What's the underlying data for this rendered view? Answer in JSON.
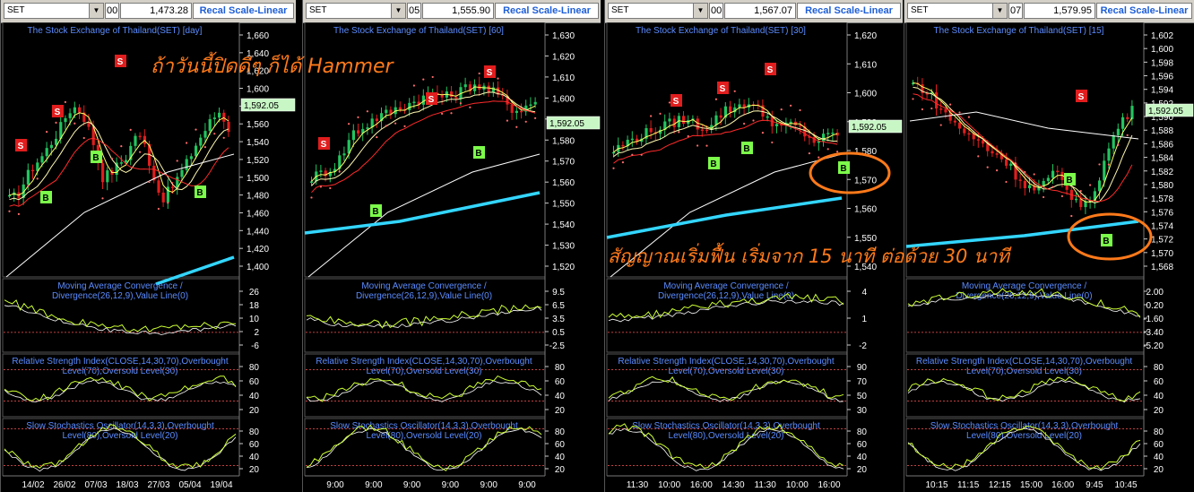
{
  "panels": [
    {
      "symbol": "SET",
      "period_box": "00",
      "price_box": "1,473.28",
      "recal_label": "Recal Scale-Linear",
      "title": "The Stock Exchange of Thailand(SET) [day]",
      "last_price": "1,592.05",
      "price_ticks": [
        "1,660",
        "1,640",
        "1,620",
        "1,600",
        "1,580",
        "1,560",
        "1,540",
        "1,520",
        "1,500",
        "1,480",
        "1,460",
        "1,440",
        "1,420",
        "1,400"
      ],
      "macd_title_1": "Moving Average Convergence /",
      "macd_title_2": "Divergence(26,12,9),Value Line(0)",
      "macd_ticks": [
        "26",
        "18",
        "10",
        "2",
        "-6"
      ],
      "rsi_title_1": "Relative Strength Index(CLOSE,14,30,70),Overbought",
      "rsi_title_2": "Level(70),Oversold Level(30)",
      "rsi_ticks": [
        "80",
        "60",
        "40",
        "20"
      ],
      "sto_title_1": "Slow Stochastics Oscillator(14,3,3),Overbought",
      "sto_title_2": "Level(80),Oversold Level(20)",
      "sto_ticks": [
        "80",
        "60",
        "40",
        "20"
      ],
      "date_ticks": [
        "14/02",
        "26/02",
        "07/03",
        "18/03",
        "27/03",
        "05/04",
        "19/04"
      ]
    },
    {
      "symbol": "SET",
      "period_box": "05",
      "price_box": "1,555.90",
      "recal_label": "Recal Scale-Linear",
      "title": "The Stock Exchange of Thailand(SET) [60]",
      "last_price": "1,592.05",
      "price_ticks": [
        "1,630",
        "1,620",
        "1,610",
        "1,600",
        "1,590",
        "1,580",
        "1,570",
        "1,560",
        "1,550",
        "1,540",
        "1,530",
        "1,520"
      ],
      "macd_title_1": "Moving Average Convergence /",
      "macd_title_2": "Divergence(26,12,9),Value Line(0)",
      "macd_ticks": [
        "9.5",
        "6.5",
        "3.5",
        "0.5",
        "-2.5"
      ],
      "rsi_title_1": "Relative Strength Index(CLOSE,14,30,70),Overbought",
      "rsi_title_2": "Level(70),Oversold Level(30)",
      "rsi_ticks": [
        "80",
        "60",
        "40",
        "20"
      ],
      "sto_title_1": "Slow Stochastics Oscillator(14,3,3),Overbought",
      "sto_title_2": "Level(80),Oversold Level(20)",
      "sto_ticks": [
        "80",
        "60",
        "40",
        "20"
      ],
      "date_ticks": [
        "9:00",
        "9:00",
        "9:00",
        "9:00",
        "9:00",
        "9:00"
      ]
    },
    {
      "symbol": "SET",
      "period_box": "00",
      "price_box": "1,567.07",
      "recal_label": "Recal Scale-Linear",
      "title": "The Stock Exchange of Thailand(SET) [30]",
      "last_price": "1,592.05",
      "price_ticks": [
        "1,620",
        "1,610",
        "1,600",
        "1,590",
        "1,580",
        "1,570",
        "1,560",
        "1,550",
        "1,540"
      ],
      "macd_title_1": "Moving Average Convergence /",
      "macd_title_2": "Divergence(26,12,9),Value Line(0)",
      "macd_ticks": [
        "4",
        "1",
        "-2"
      ],
      "rsi_title_1": "Relative Strength Index(CLOSE,14,30,70),Overbought",
      "rsi_title_2": "Level(70),Oversold Level(30)",
      "rsi_ticks": [
        "90",
        "70",
        "50",
        "30"
      ],
      "sto_title_1": "Slow Stochastics Oscillator(14,3,3),Overbought",
      "sto_title_2": "Level(80),Oversold Level(20)",
      "sto_ticks": [
        "80",
        "60",
        "40",
        "20"
      ],
      "date_ticks": [
        "11:30",
        "10:00",
        "16:00",
        "14:30",
        "11:30",
        "10:00",
        "16:00"
      ]
    },
    {
      "symbol": "SET",
      "period_box": "07",
      "price_box": "1,579.95",
      "recal_label": "Recal Scale-Linear",
      "title": "The Stock Exchange of Thailand(SET) [15]",
      "last_price": "1,592.05",
      "price_ticks": [
        "1,602",
        "1,600",
        "1,598",
        "1,596",
        "1,594",
        "1,592",
        "1,590",
        "1,588",
        "1,586",
        "1,584",
        "1,582",
        "1,580",
        "1,578",
        "1,576",
        "1,574",
        "1,572",
        "1,570",
        "1,568"
      ],
      "macd_title_1": "Moving Average Convergence /",
      "macd_title_2": "Divergence(26,12,9),Value Line(0)",
      "macd_ticks": [
        "2.00",
        "0.20",
        "-1.60",
        "-3.40",
        "-5.20"
      ],
      "rsi_title_1": "Relative Strength Index(CLOSE,14,30,70),Overbought",
      "rsi_title_2": "Level(70),Oversold Level(30)",
      "rsi_ticks": [
        "80",
        "60",
        "40",
        "20"
      ],
      "sto_title_1": "Slow Stochastics Oscillator(14,3,3),Overbought",
      "sto_title_2": "Level(80),Oversold Level(20)",
      "sto_ticks": [
        "80",
        "60",
        "40",
        "20"
      ],
      "date_ticks": [
        "10:15",
        "11:15",
        "12:15",
        "15:00",
        "16:00",
        "9:45",
        "10:45"
      ]
    }
  ],
  "annotations": {
    "hammer_note": "ถ้าวันนี้ปิดดีๆ ก็ได้ Hammer",
    "signal_note": "สัญญาณเริ่มฟื้น เริ่มจาก 15 นาที ต่อด้วย 30 นาที"
  },
  "signals": {
    "sell": "S",
    "buy": "B"
  },
  "colors": {
    "background": "#000000",
    "candle_up": "#22c55e",
    "candle_down": "#e11d1d",
    "ma_short": "#ffff66",
    "ma_mid": "#ff2a2a",
    "ma_long": "#ffffff",
    "ma_200": "#33d6ff",
    "title_blue": "#5b8cff",
    "annotation": "#ff7a1a",
    "macd_line": "#ccff33",
    "level_line": "#ff5555"
  }
}
